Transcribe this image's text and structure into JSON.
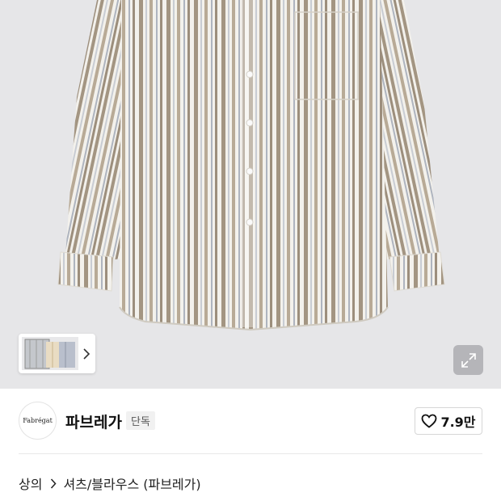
{
  "product_image": {
    "alt": "striped shirt",
    "colors": {
      "background": "#e6e6e8",
      "stripe_brown": "#9c8e7c",
      "stripe_gray": "#b7bcc6",
      "fabric": "#f3f1ec"
    }
  },
  "thumbnail_strip": {
    "next_icon": "chevron-right-icon"
  },
  "expand_button": {
    "icon": "expand-arrows-icon"
  },
  "brand": {
    "logo_text": "Fabrégat",
    "name": "파브레가",
    "badge": "단독"
  },
  "like": {
    "icon": "heart-outline-icon",
    "count": "7.9만"
  },
  "breadcrumb": {
    "items": [
      "상의",
      "셔츠/블라우스 (파브레가)"
    ],
    "separator_icon": "chevron-right-icon"
  }
}
